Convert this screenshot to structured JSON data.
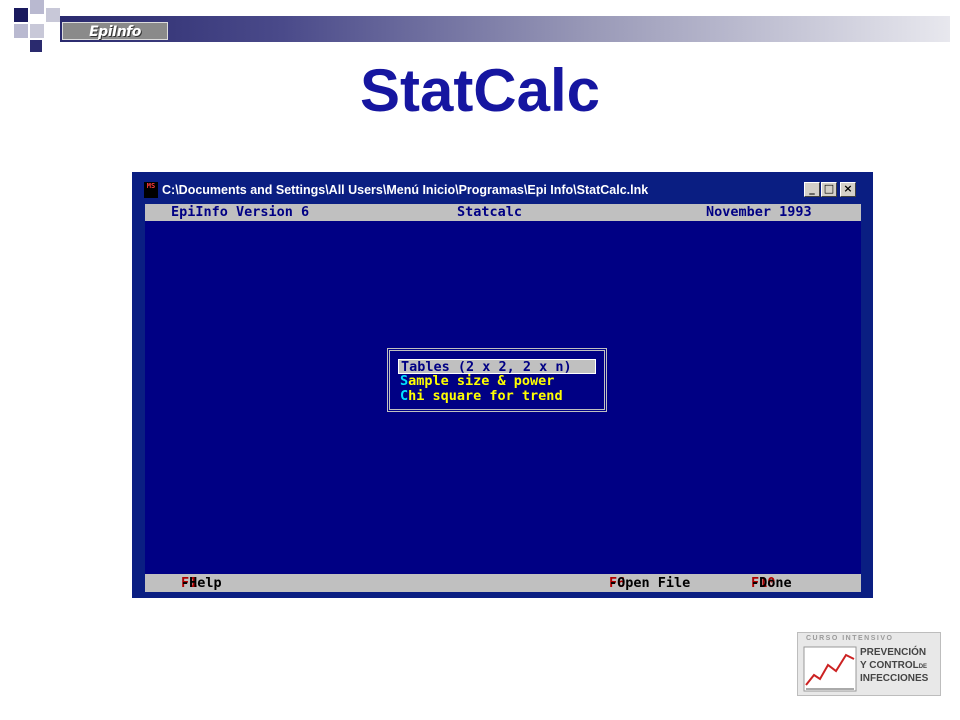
{
  "slide": {
    "title": "StatCalc",
    "header_badge": "EpiInfo"
  },
  "window": {
    "title": "C:\\Documents and Settings\\All Users\\Menú Inicio\\Programas\\Epi Info\\StatCalc.lnk",
    "icon_text": "MS",
    "buttons": {
      "minimize": "_",
      "maximize": "□",
      "close": "×"
    }
  },
  "console": {
    "header": {
      "left": "EpiInfo Version 6",
      "center": "Statcalc",
      "right": "November 1993"
    },
    "menu": {
      "items": [
        {
          "label": "Tables (2 x 2, 2 x n)",
          "selected": true
        },
        {
          "hotkey": "S",
          "rest": "ample size & power",
          "selected": false
        },
        {
          "hotkey": "C",
          "rest": "hi square for trend",
          "selected": false
        }
      ]
    },
    "footer": {
      "help_key": "F1",
      "help_label": "-Help",
      "open_key": "F6",
      "open_label": "-Open File",
      "done_key": "F10",
      "done_label": "-Done"
    }
  },
  "logo": {
    "top_text": "CURSO INTENSIVO",
    "line1": "PREVENCIÓN",
    "line2": "Y CONTROL",
    "line2_small": "DE",
    "line3": "INFECCIONES"
  },
  "colors": {
    "title": "#1616a0",
    "console_bg": "#000084",
    "menu_text": "#ffff00",
    "hotkey": "#00e0ff",
    "fkey": "#b00000"
  }
}
